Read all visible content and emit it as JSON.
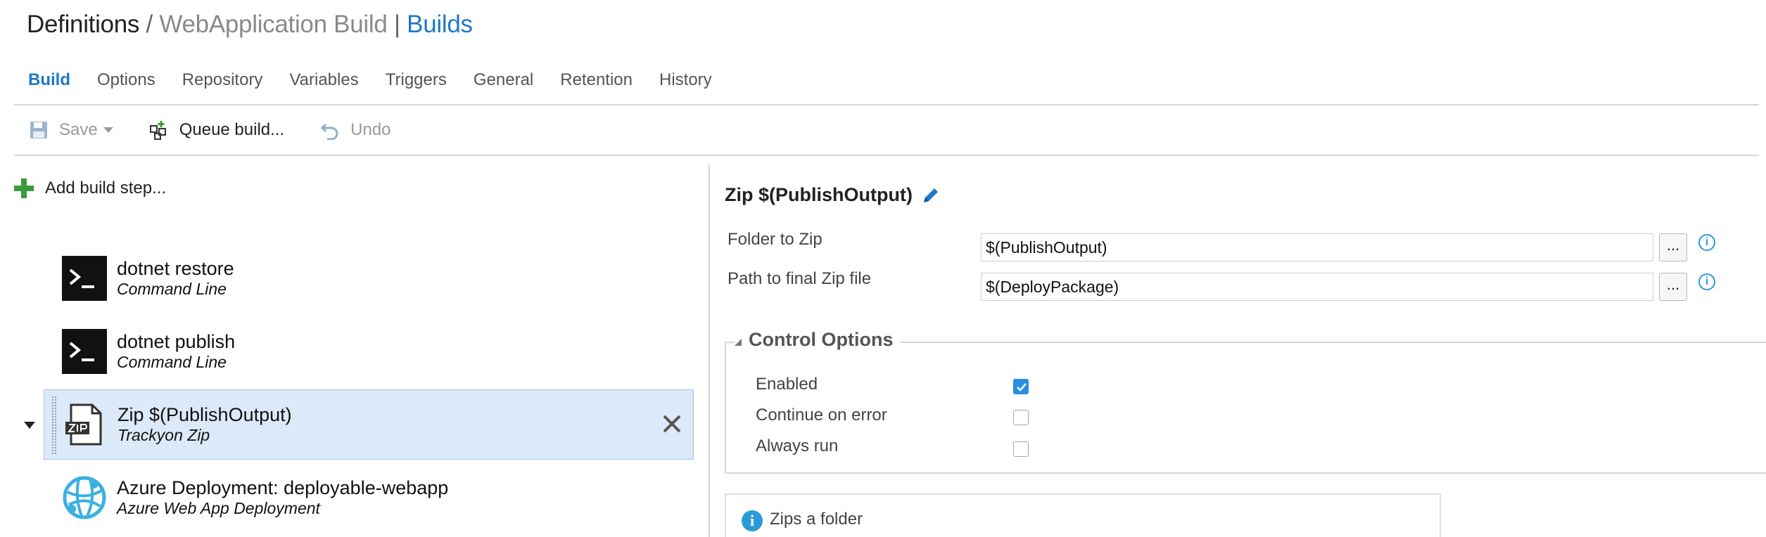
{
  "header": {
    "crumb": "Definitions",
    "slash": " / ",
    "definition_name": "WebApplication Build",
    "pipe": " | ",
    "section": "Builds"
  },
  "tabs": [
    {
      "label": "Build",
      "active": true
    },
    {
      "label": "Options"
    },
    {
      "label": "Repository"
    },
    {
      "label": "Variables"
    },
    {
      "label": "Triggers"
    },
    {
      "label": "General"
    },
    {
      "label": "Retention"
    },
    {
      "label": "History"
    }
  ],
  "toolbar": {
    "save_label": "Save",
    "queue_label": "Queue build...",
    "undo_label": "Undo"
  },
  "steps_pane": {
    "add_label": "Add build step...",
    "steps": [
      {
        "name": "dotnet restore",
        "type": "Command Line",
        "icon": "terminal-icon"
      },
      {
        "name": "dotnet publish",
        "type": "Command Line",
        "icon": "terminal-icon"
      },
      {
        "name": "Zip $(PublishOutput)",
        "type": "Trackyon Zip",
        "icon": "zip-file-icon",
        "selected": true
      },
      {
        "name": "Azure Deployment: deployable-webapp",
        "type": "Azure Web App Deployment",
        "icon": "azure-web-app-icon"
      }
    ]
  },
  "task": {
    "title": "Zip $(PublishOutput)",
    "fields": [
      {
        "label": "Folder to Zip",
        "value": "$(PublishOutput)"
      },
      {
        "label": "Path to final Zip file",
        "value": "$(DeployPackage)"
      }
    ],
    "ellipsis": "...",
    "info_glyph": "i",
    "control_options": {
      "title": "Control Options",
      "options": [
        {
          "label": "Enabled",
          "checked": true
        },
        {
          "label": "Continue on error",
          "checked": false
        },
        {
          "label": "Always run",
          "checked": false
        }
      ]
    },
    "help_text": "Zips a folder"
  },
  "colors": {
    "accent": "#1e78c8",
    "selected_bg": "#dbe9f8",
    "add_green": "#3a9a3a",
    "info_blue": "#2b9bd8"
  }
}
